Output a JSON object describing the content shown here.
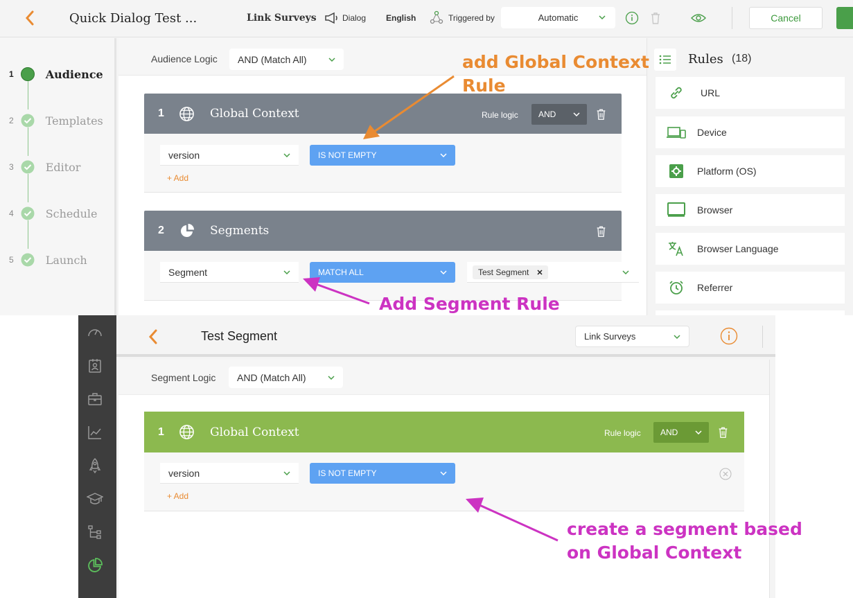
{
  "top": {
    "header": {
      "title": "Quick Dialog Test ...",
      "type_label": "Link Surveys",
      "format_label": "Dialog",
      "language": "English",
      "triggered_by_label": "Triggered by",
      "trigger_value": "Automatic",
      "cancel_label": "Cancel"
    },
    "steps": [
      {
        "num": "1",
        "label": "Audience",
        "state": "active"
      },
      {
        "num": "2",
        "label": "Templates",
        "state": "done"
      },
      {
        "num": "3",
        "label": "Editor",
        "state": "done"
      },
      {
        "num": "4",
        "label": "Schedule",
        "state": "done"
      },
      {
        "num": "5",
        "label": "Launch",
        "state": "done"
      }
    ],
    "audience_logic": {
      "label": "Audience Logic",
      "value": "AND (Match All)"
    },
    "cards": [
      {
        "num": "1",
        "title": "Global Context",
        "icon": "globe-icon",
        "rule_logic_label": "Rule logic",
        "rule_logic_value": "AND",
        "field": "version",
        "operator": "IS NOT EMPTY",
        "add_label": "+ Add"
      },
      {
        "num": "2",
        "title": "Segments",
        "icon": "pie-chart-icon",
        "field": "Segment",
        "operator": "MATCH ALL",
        "tag": "Test Segment"
      }
    ],
    "rules_panel": {
      "title": "Rules",
      "count": "(18)",
      "items": [
        {
          "label": "URL",
          "icon": "link-icon"
        },
        {
          "label": "Device",
          "icon": "device-icon"
        },
        {
          "label": "Platform (OS)",
          "icon": "platform-icon"
        },
        {
          "label": "Browser",
          "icon": "browser-icon"
        },
        {
          "label": "Browser Language",
          "icon": "translate-icon"
        },
        {
          "label": "Referrer",
          "icon": "alarm-clock-icon"
        }
      ]
    }
  },
  "bottom": {
    "header": {
      "title": "Test Segment",
      "type_value": "Link Surveys"
    },
    "segment_logic": {
      "label": "Segment Logic",
      "value": "AND (Match All)"
    },
    "card": {
      "num": "1",
      "title": "Global Context",
      "rule_logic_label": "Rule logic",
      "rule_logic_value": "AND",
      "field": "version",
      "operator": "IS NOT EMPTY",
      "add_label": "+ Add"
    },
    "sidebar_icons": [
      "speedometer-icon",
      "contacts-icon",
      "briefcase-icon",
      "analytics-icon",
      "rocket-icon",
      "graduation-cap-icon",
      "hierarchy-icon",
      "segments-pie-icon"
    ]
  },
  "annotations": {
    "global_context": "add Global Context\nRule",
    "segment_rule": "Add Segment Rule",
    "create_segment": "create a segment based\non Global Context"
  },
  "colors": {
    "accent_orange": "#e98b32",
    "annotation_pink": "#cc33c2",
    "green": "#4a9f4a",
    "card_gray": "#7a828c",
    "card_green": "#8cb94f",
    "blue_select": "#5ea2f2"
  }
}
